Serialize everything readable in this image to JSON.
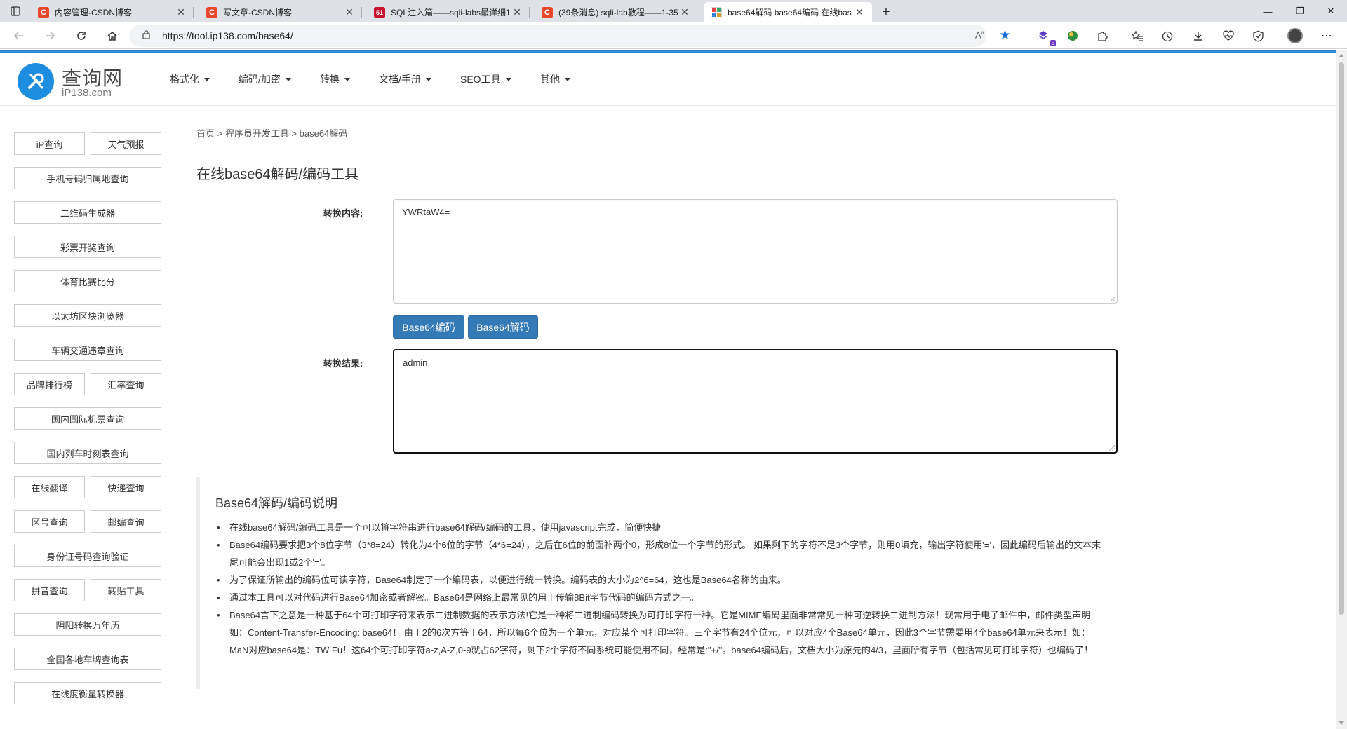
{
  "browser": {
    "tabs": [
      {
        "title": "内容管理-CSDN博客",
        "favicon": "C",
        "favicon_color": "#e8472b",
        "active": false
      },
      {
        "title": "写文章-CSDN博客",
        "favicon": "C",
        "favicon_color": "#e8472b",
        "active": false
      },
      {
        "title": "SQL注入篇——sqli-labs最详细1-",
        "favicon": "51",
        "favicon_color": "#c8102e",
        "active": false
      },
      {
        "title": "(39条消息) sqli-lab教程——1-35",
        "favicon": "C",
        "favicon_color": "#e8472b",
        "active": false
      },
      {
        "title": "base64解码 base64编码 在线bas",
        "favicon": "X",
        "favicon_color": "#38a169",
        "active": true
      }
    ],
    "url": "https://tool.ip138.com/base64/",
    "extension_badge": "5",
    "window_controls": {
      "minimize": "—",
      "restore": "❐",
      "close": "✕"
    },
    "new_tab": "+"
  },
  "site": {
    "logo_title": "查询网",
    "logo_sub": "iP138.com",
    "nav": [
      "格式化",
      "编码/加密",
      "转换",
      "文档/手册",
      "SEO工具",
      "其他"
    ]
  },
  "sidebar": {
    "rows": [
      [
        "iP查询",
        "天气预报"
      ],
      [
        "手机号码归属地查询"
      ],
      [
        "二维码生成器"
      ],
      [
        "彩票开奖查询"
      ],
      [
        "体育比赛比分"
      ],
      [
        "以太坊区块浏览器"
      ],
      [
        "车辆交通违章查询"
      ],
      [
        "品牌排行榜",
        "汇率查询"
      ],
      [
        "国内国际机票查询"
      ],
      [
        "国内列车时刻表查询"
      ],
      [
        "在线翻译",
        "快递查询"
      ],
      [
        "区号查询",
        "邮编查询"
      ],
      [
        "身份证号码查询验证"
      ],
      [
        "拼音查询",
        "转贴工具"
      ],
      [
        "阴阳转换万年历"
      ],
      [
        "全国各地车牌查询表"
      ],
      [
        "在线度衡量转换器"
      ]
    ]
  },
  "main": {
    "breadcrumb": "首页 > 程序员开发工具 > base64解码",
    "title": "在线base64解码/编码工具",
    "input_label": "转换内容:",
    "input_value": "YWRtaW4=",
    "encode_button": "Base64编码",
    "decode_button": "Base64解码",
    "output_label": "转换结果:",
    "output_value": "admin",
    "desc_title": "Base64解码/编码说明",
    "desc_items": [
      "在线base64解码/编码工具是一个可以将字符串进行base64解码/编码的工具，使用javascript完成，简便快捷。",
      "Base64编码要求把3个8位字节（3*8=24）转化为4个6位的字节（4*6=24），之后在6位的前面补两个0，形成8位一个字节的形式。 如果剩下的字符不足3个字节，则用0填充，输出字符使用'='，因此编码后输出的文本末尾可能会出现1或2个'='。",
      "为了保证所输出的编码位可读字符，Base64制定了一个编码表，以便进行统一转换。编码表的大小为2^6=64，这也是Base64名称的由来。",
      "通过本工具可以对代码进行Base64加密或者解密。Base64是网络上最常见的用于传输8Bit字节代码的编码方式之一。",
      "Base64言下之意是一种基于64个可打印字符来表示二进制数据的表示方法!它是一种将二进制编码转换为可打印字符一种。它是MIME编码里面非常常见一种可逆转换二进制方法！现常用于电子邮件中，邮件类型声明如：Content-Transfer-Encoding: base64！ 由于2的6次方等于64，所以每6个位为一个单元，对应某个可打印字符。三个字节有24个位元，可以对应4个Base64单元，因此3个字节需要用4个base64单元来表示！如：MaN对应base64是：TW Fu！这64个可打印字符a-z,A-Z,0-9就占62字符，剩下2个字符不同系统可能使用不同，经常是:\"+/\"。base64编码后，文档大小为原先的4/3，里面所有字节（包括常见可打印字符）也编码了！"
    ]
  }
}
